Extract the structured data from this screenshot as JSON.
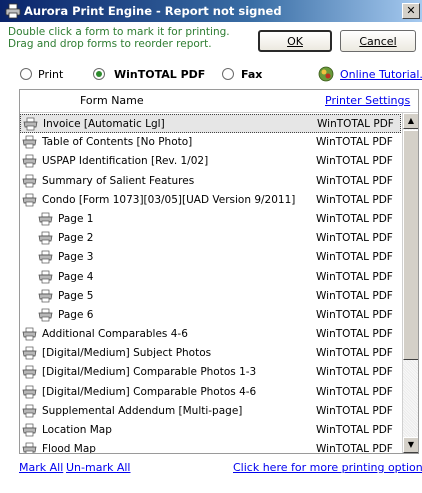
{
  "window": {
    "title": "Aurora Print Engine - Report not signed",
    "close": "✕"
  },
  "instructions": "Double click a form to mark it for printing.  Drag and drop forms to reorder report.",
  "buttons": {
    "ok": "OK",
    "cancel": "Cancel"
  },
  "output_options": [
    {
      "label": "Print",
      "selected": false
    },
    {
      "label": "WinTOTAL PDF",
      "selected": true
    },
    {
      "label": "Fax",
      "selected": false
    }
  ],
  "tutorial_link": "Online Tutorial...",
  "list": {
    "headers": {
      "form_name": "Form Name",
      "printer_settings": "Printer Settings"
    },
    "rows": [
      {
        "name": "Invoice [Automatic Lgl]",
        "printer": "WinTOTAL PDF",
        "indent": false,
        "selected": true
      },
      {
        "name": "Table of Contents [No Photo]",
        "printer": "WinTOTAL PDF",
        "indent": false,
        "selected": false
      },
      {
        "name": "USPAP Identification [Rev. 1/02]",
        "printer": "WinTOTAL PDF",
        "indent": false,
        "selected": false
      },
      {
        "name": "Summary of Salient Features",
        "printer": "WinTOTAL PDF",
        "indent": false,
        "selected": false
      },
      {
        "name": "Condo [Form 1073][03/05][UAD Version 9/2011]",
        "printer": "WinTOTAL PDF",
        "indent": false,
        "selected": false
      },
      {
        "name": "Page 1",
        "printer": "WinTOTAL PDF",
        "indent": true,
        "selected": false
      },
      {
        "name": "Page 2",
        "printer": "WinTOTAL PDF",
        "indent": true,
        "selected": false
      },
      {
        "name": "Page 3",
        "printer": "WinTOTAL PDF",
        "indent": true,
        "selected": false
      },
      {
        "name": "Page 4",
        "printer": "WinTOTAL PDF",
        "indent": true,
        "selected": false
      },
      {
        "name": "Page 5",
        "printer": "WinTOTAL PDF",
        "indent": true,
        "selected": false
      },
      {
        "name": "Page 6",
        "printer": "WinTOTAL PDF",
        "indent": true,
        "selected": false
      },
      {
        "name": "Additional Comparables 4-6",
        "printer": "WinTOTAL PDF",
        "indent": false,
        "selected": false
      },
      {
        "name": "[Digital/Medium] Subject Photos",
        "printer": "WinTOTAL PDF",
        "indent": false,
        "selected": false
      },
      {
        "name": "[Digital/Medium] Comparable Photos 1-3",
        "printer": "WinTOTAL PDF",
        "indent": false,
        "selected": false
      },
      {
        "name": "[Digital/Medium] Comparable Photos 4-6",
        "printer": "WinTOTAL PDF",
        "indent": false,
        "selected": false
      },
      {
        "name": "Supplemental Addendum [Multi-page]",
        "printer": "WinTOTAL PDF",
        "indent": false,
        "selected": false
      },
      {
        "name": "Location Map",
        "printer": "WinTOTAL PDF",
        "indent": false,
        "selected": false
      },
      {
        "name": "Flood Map",
        "printer": "WinTOTAL PDF",
        "indent": false,
        "selected": false
      }
    ]
  },
  "footer": {
    "mark_all": "Mark All",
    "unmark_all": "Un-mark All",
    "more_options": "Click here for more printing options"
  },
  "colors": {
    "instruction_text": "#2e7d32",
    "link": "#0000ee",
    "titlebar": "#0a246a"
  }
}
